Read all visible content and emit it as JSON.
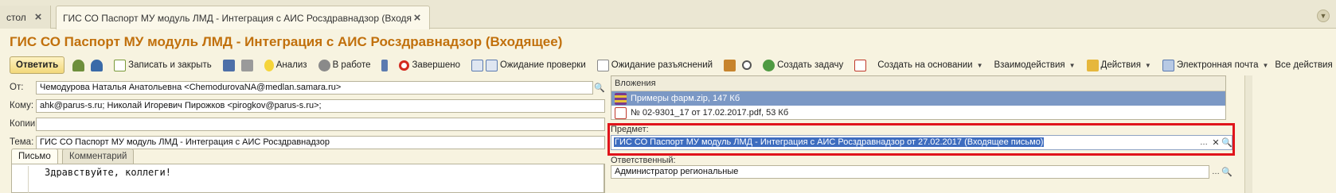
{
  "tabs": [
    {
      "label": "стол"
    },
    {
      "label": "ГИС СО Паспорт МУ модуль ЛМД - Интеграция с АИС Росздравнадзор (Входящее)"
    }
  ],
  "title": "ГИС СО Паспорт МУ модуль ЛМД - Интеграция с АИС Росздравнадзор (Входящее)",
  "toolbar": {
    "reply": "Ответить",
    "save_close": "Записать и закрыть",
    "analysis": "Анализ",
    "in_work": "В работе",
    "completed": "Завершено",
    "wait_check": "Ожидание проверки",
    "wait_clarify": "Ожидание разъяснений",
    "create_task": "Создать задачу",
    "create_based": "Создать на основании",
    "interactions": "Взаимодействия",
    "actions": "Действия",
    "email": "Электронная почта",
    "all_actions": "Все действия",
    "help": "?"
  },
  "form": {
    "from_label": "От:",
    "from_value": "Чемодурова Наталья Анатольевна <ChemodurovaNA@medlan.samara.ru>",
    "to_label": "Кому:",
    "to_value": "ahk@parus-s.ru; Николай Игоревич Пирожков <pirogkov@parus-s.ru>;",
    "cc_label": "Копии:",
    "cc_value": "",
    "subject_label": "Тема:",
    "subject_value": "ГИС СО Паспорт МУ модуль ЛМД - Интеграция с АИС Росздравнадзор"
  },
  "subtabs": {
    "letter": "Письмо",
    "comment": "Комментарий"
  },
  "letter_text": "Здравствуйте, коллеги!",
  "attachments": {
    "header": "Вложения",
    "items": [
      {
        "name": "Примеры фарм.zip, 147 Кб",
        "selected": true,
        "icon": "zip-archive-icon"
      },
      {
        "name": "№ 02-9301_17 от 17.02.2017.pdf, 53 Кб",
        "selected": false,
        "icon": "pdf-file-icon"
      }
    ]
  },
  "subject_item": {
    "label": "Предмет:",
    "value": "ГИС СО Паспорт МУ модуль ЛМД - Интеграция с АИС Росздравнадзор от 27.02.2017 (Входящее письмо)"
  },
  "responsible": {
    "label": "Ответственный:",
    "value": "Администратор региональные"
  },
  "colors": {
    "title": "#c1700c",
    "highlight_box": "#e0141b",
    "selection": "#7b98c5"
  }
}
